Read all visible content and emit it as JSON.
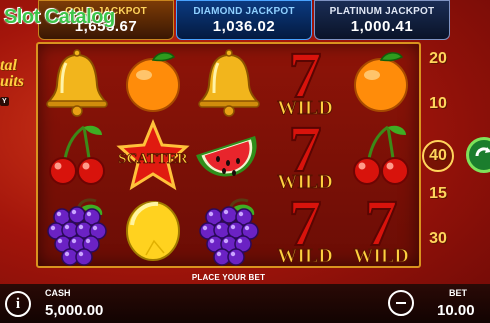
{
  "watermark": "Slot Catalog",
  "logo": {
    "line1": "tal",
    "line2": "uits",
    "tag": "Y"
  },
  "jackpots": [
    {
      "label": "GOLD JACKPOT",
      "value": "1,655.67"
    },
    {
      "label": "DIAMOND JACKPOT",
      "value": "1,036.02"
    },
    {
      "label": "PLATINUM JACKPOT",
      "value": "1,000.41"
    }
  ],
  "reels": [
    [
      "bell",
      "cherry",
      "grapes"
    ],
    [
      "orange",
      "scatter",
      "lemon"
    ],
    [
      "bell",
      "watermelon",
      "grapes"
    ],
    [
      "wild-seven",
      "wild-seven",
      "wild-seven"
    ],
    [
      "orange",
      "cherry",
      "wild-seven"
    ]
  ],
  "symbol_text": {
    "wild": "WILD",
    "scatter": "SCATTER",
    "seven": "7"
  },
  "lines": [
    "20",
    "10",
    "40",
    "15",
    "30"
  ],
  "active_line": "40",
  "place_bet": "PLACE YOUR BET",
  "footer": {
    "info": "i",
    "cash_label": "CASH",
    "cash_value": "5,000.00",
    "bet_label": "BET",
    "bet_value": "10.00"
  },
  "colors": {
    "gold": "#ffd45c",
    "frame": "#d9931f",
    "seven": "#d8130c",
    "spin": "#1b7d2d"
  }
}
